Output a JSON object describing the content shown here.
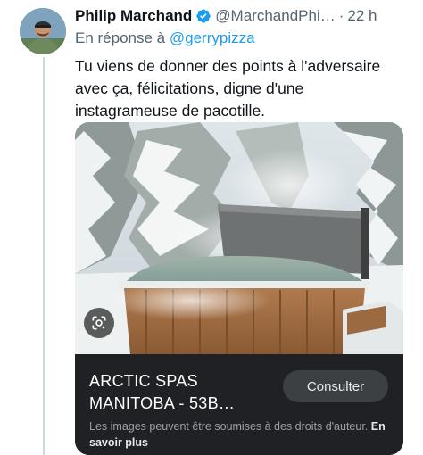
{
  "tweet": {
    "display_name": "Philip Marchand",
    "handle": "@MarchandPhi…",
    "separator": "·",
    "time": "22 h",
    "reply_prefix": "En réponse à",
    "reply_mention": "@gerrypizza",
    "text": "Tu viens de donner des points à l'adversaire avec ça, félicitations, digne d'une instagrameuse de pacotille.",
    "verified_color": "#1d9bf0"
  },
  "card": {
    "title": "ARCTIC SPAS MANITOBA - 53B…",
    "action_label": "Consulter",
    "copyright_text": "Les images peuvent être soumises à des droits d'auteur.",
    "learn_more_label": "En savoir plus"
  },
  "icons": {
    "verified": "verified-badge-icon",
    "lens": "google-lens-icon"
  }
}
